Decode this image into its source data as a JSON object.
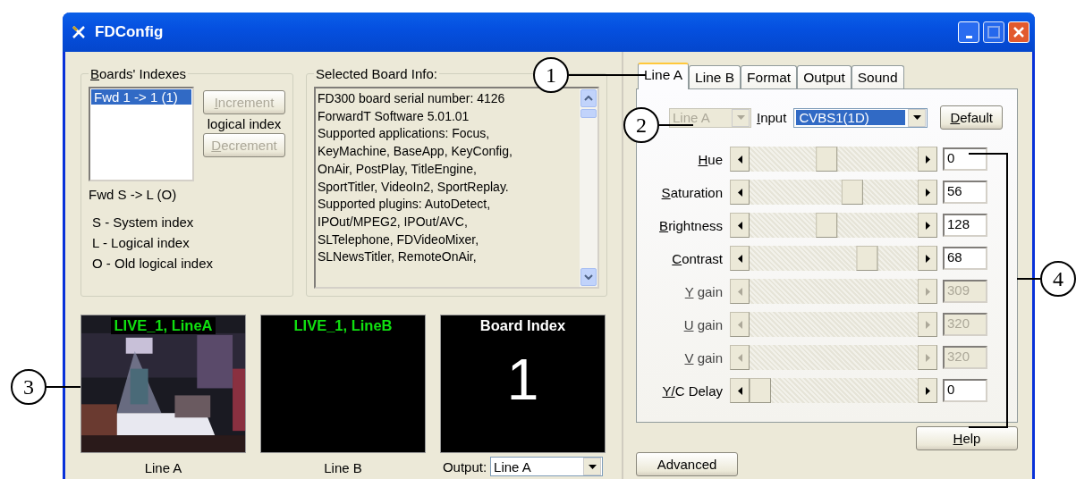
{
  "window": {
    "title": "FDConfig"
  },
  "boards_indexes": {
    "title": "Boards' Indexes",
    "items": [
      {
        "label": "Fwd 1 -> 1 (1)",
        "selected": true
      }
    ],
    "increment": {
      "label": "Increment",
      "disabled": true
    },
    "between_label": "logical index",
    "decrement": {
      "label": "Decrement",
      "disabled": true
    },
    "mapping": "Fwd S -> L (O)",
    "legend": [
      "S - System index",
      "L - Logical index",
      "O - Old logical index"
    ]
  },
  "board_info": {
    "title": "Selected Board Info:",
    "lines": [
      "FD300 board serial number: 4126",
      "ForwardT Software 5.01.01",
      "Supported applications: Focus,",
      "KeyMachine, BaseApp, KeyConfig,",
      "OnAir, PostPlay, TitleEngine,",
      "SportTitler, VideoIn2, SportReplay.",
      "Supported plugins: AutoDetect,",
      "IPOut/MPEG2, IPOut/AVC,",
      "SLTelephone, FDVideoMixer,",
      "SLNewsTitler, RemoteOnAir,"
    ]
  },
  "previews": [
    {
      "kind": "video",
      "title": "LIVE_1, LineA",
      "caption": "Line A"
    },
    {
      "kind": "blank",
      "title": "LIVE_1, LineB",
      "caption": "Line B"
    },
    {
      "kind": "index",
      "title": "Board Index",
      "value": "1"
    }
  ],
  "output": {
    "label": "Output:",
    "value": "Line A"
  },
  "tabs": [
    {
      "label": "Line A",
      "selected": true
    },
    {
      "label": "Line B",
      "selected": false
    },
    {
      "label": "Format",
      "selected": false
    },
    {
      "label": "Output",
      "selected": false
    },
    {
      "label": "Sound",
      "selected": false
    }
  ],
  "line_select": {
    "value": "Line A",
    "disabled": true
  },
  "input": {
    "label": "Input",
    "value": "CVBS1(1D)"
  },
  "default_button": "Default",
  "sliders": [
    {
      "label": "Hue",
      "level": 0.45,
      "value": "0",
      "disabled": false
    },
    {
      "label": "Saturation",
      "level": 0.63,
      "value": "56",
      "disabled": false
    },
    {
      "label": "Brightness",
      "level": 0.45,
      "value": "128",
      "disabled": false
    },
    {
      "label": "Contrast",
      "level": 0.73,
      "value": "68",
      "disabled": false
    },
    {
      "label": "Y gain",
      "value": "309",
      "disabled": true
    },
    {
      "label": "U gain",
      "value": "320",
      "disabled": true
    },
    {
      "label": "V gain",
      "value": "320",
      "disabled": true
    },
    {
      "label": "Y/C Delay",
      "level": 0,
      "value": "0",
      "disabled": false
    }
  ],
  "help_button": "Help",
  "advanced_button": "Advanced",
  "callouts": [
    "1",
    "2",
    "3",
    "4"
  ]
}
